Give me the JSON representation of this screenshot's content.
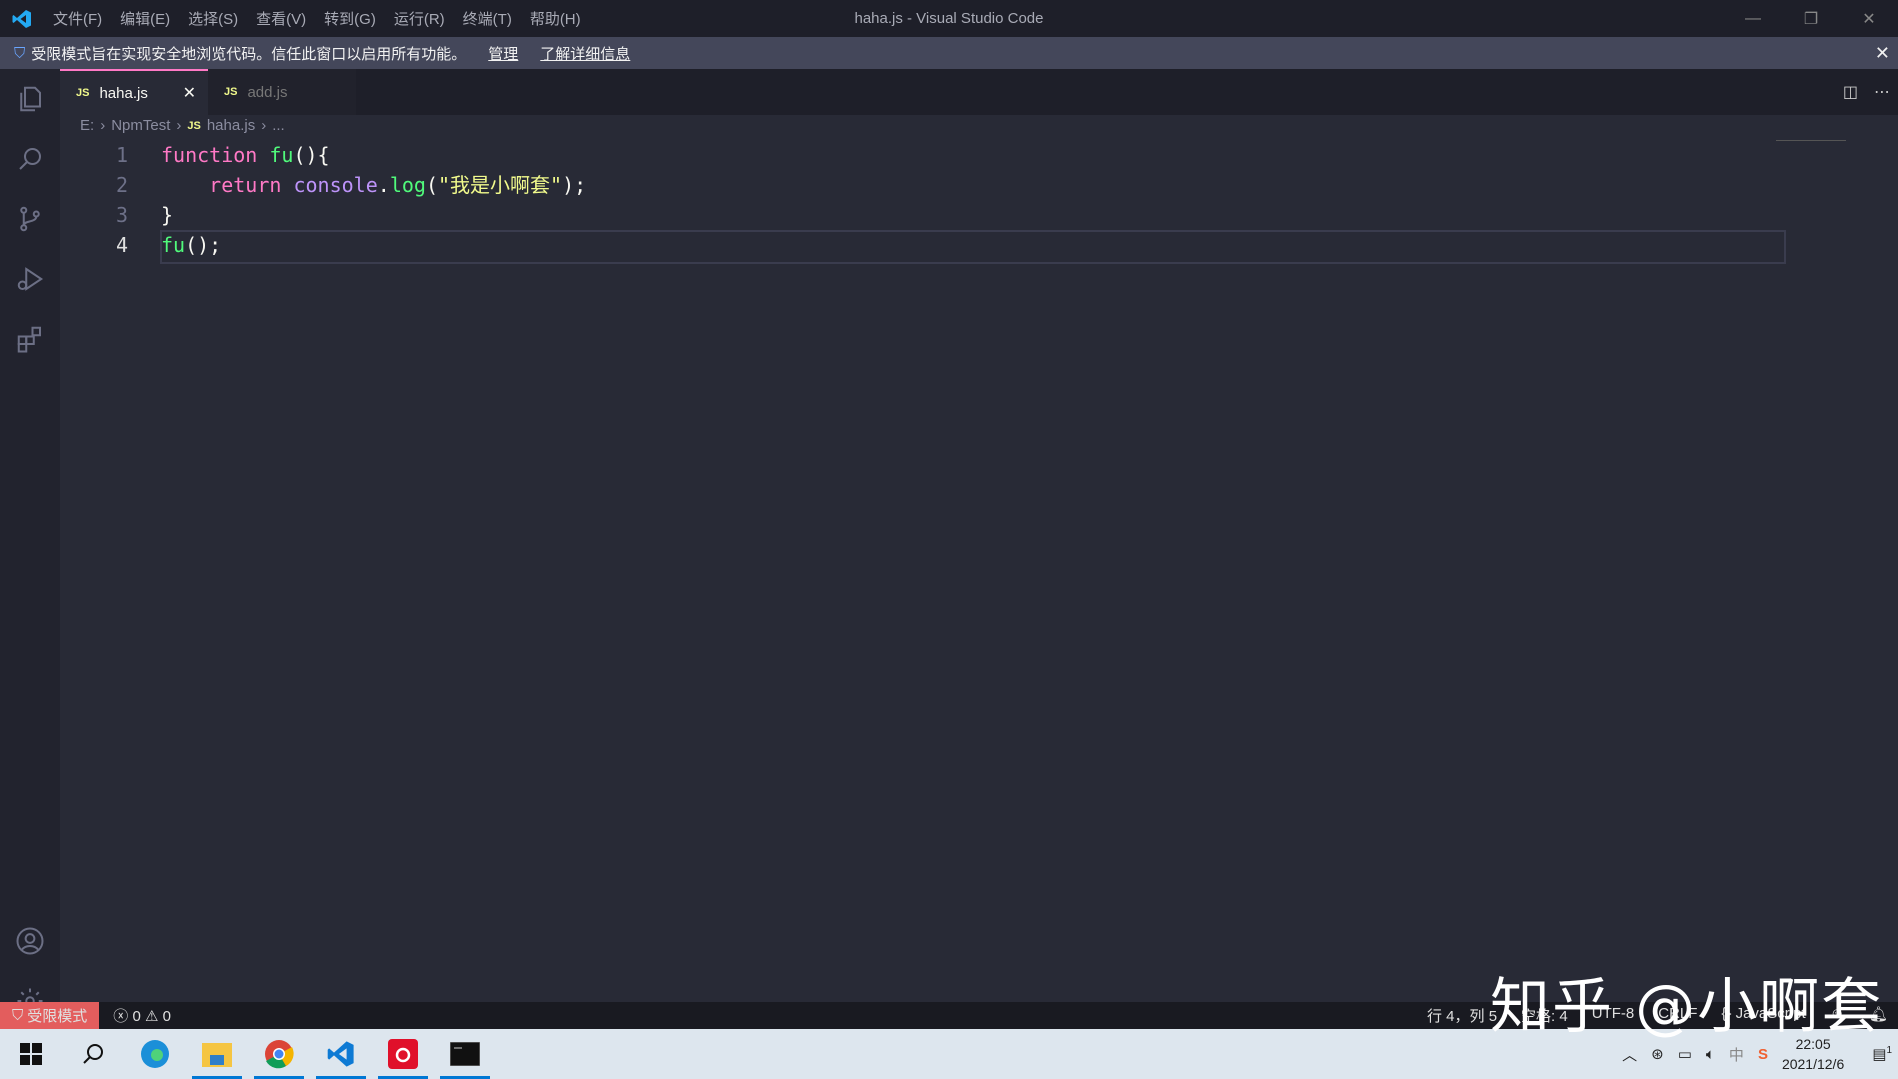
{
  "window": {
    "title": "haha.js - Visual Studio Code"
  },
  "menu": [
    "文件(F)",
    "编辑(E)",
    "选择(S)",
    "查看(V)",
    "转到(G)",
    "运行(R)",
    "终端(T)",
    "帮助(H)"
  ],
  "banner": {
    "text": "受限模式旨在实现安全地浏览代码。信任此窗口以启用所有功能。",
    "manage": "管理",
    "learn_more": "了解详细信息"
  },
  "tabs": [
    {
      "label": "haha.js",
      "icon": "JS",
      "active": true
    },
    {
      "label": "add.js",
      "icon": "JS",
      "active": false
    }
  ],
  "breadcrumb": [
    "E:",
    "NpmTest",
    "haha.js",
    "..."
  ],
  "breadcrumb_icon": "JS",
  "code": {
    "line_numbers": [
      "1",
      "2",
      "3",
      "4"
    ],
    "current_line": 4
  },
  "status": {
    "restricted": "受限模式",
    "errors": "0",
    "warnings": "0",
    "position": "行 4，列 5",
    "spaces": "空格: 4",
    "encoding": "UTF-8",
    "eol": "CRLF",
    "language": "{} JavaScript"
  },
  "taskbar": {
    "time": "22:05",
    "date": "2021/12/6",
    "ime": "中",
    "notifications": "1"
  },
  "watermark": "知乎 @小啊套",
  "colors": {
    "keyword": "#ff79c6",
    "function": "#50fa7b",
    "object": "#bd93f9",
    "string": "#f1fa8c",
    "restricted": "#e35d5d"
  }
}
